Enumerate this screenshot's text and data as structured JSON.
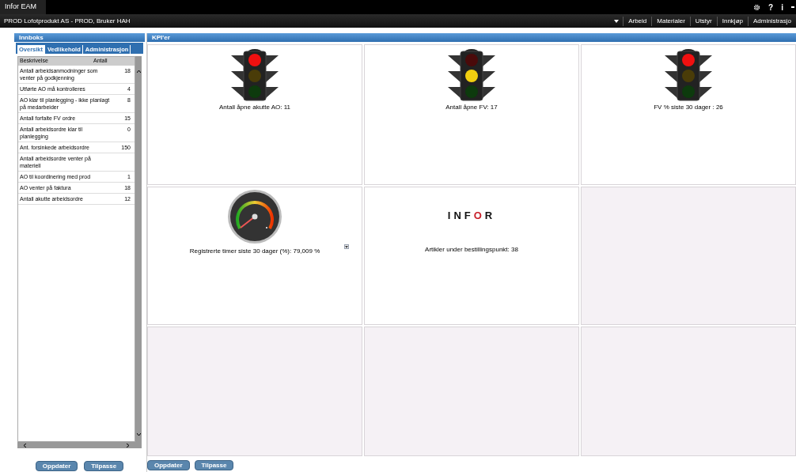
{
  "app": {
    "title": "Infor EAM",
    "context": "PROD Lofotprodukt AS - PROD, Bruker HAH",
    "top_icons": [
      "?",
      "i"
    ],
    "menu": [
      "Arbeid",
      "Materialer",
      "Utstyr",
      "Innkjøp",
      "Administrasjo"
    ]
  },
  "inbox": {
    "title": "Innboks",
    "tabs": [
      {
        "label": "Oversikt",
        "selected": true
      },
      {
        "label": "Vedlikehold",
        "selected": false
      },
      {
        "label": "Administrasjon",
        "selected": false
      }
    ],
    "columns": [
      "Beskrivelse",
      "Antall"
    ],
    "rows": [
      {
        "description": "Antall arbeidsanmodninger som venter på godkjenning",
        "count": "18"
      },
      {
        "description": "Utførte AO må kontrolleres",
        "count": "4"
      },
      {
        "description": "AO klar til planlegging - ikke planlagt på medarbeider",
        "count": "8"
      },
      {
        "description": "Antall  forfalte FV ordre",
        "count": "15"
      },
      {
        "description": "Antall arbeidsordre klar til planlegging",
        "count": "0"
      },
      {
        "description": "Ant. forsinkede arbeidsordre",
        "count": "150"
      },
      {
        "description": "Antall arbeidsordre venter på materiell"
      },
      {
        "description": "AO til koordinering med prod",
        "count": "1"
      },
      {
        "description": "AO venter på faktura",
        "count": "18"
      },
      {
        "description": "Antall akutte arbeidsordre",
        "count": "12"
      }
    ],
    "buttons": [
      "Oppdater",
      "Tilpasse"
    ]
  },
  "kpi": {
    "title": "KPI'er",
    "tiles": [
      {
        "kind": "traffic",
        "color": "#f01010",
        "caption": "Antall åpne akutte AO: 11"
      },
      {
        "kind": "traffic",
        "color": "#f2cf10",
        "caption": "Antall åpne FV: 17"
      },
      {
        "kind": "traffic",
        "color": "#f01010",
        "caption": "FV % siste 30 dager : 26"
      },
      {
        "kind": "gauge",
        "caption": "Registrerte timer siste 30 dager (%): 79,009 %"
      },
      {
        "kind": "logo",
        "logo": "INFOR",
        "caption": "Artikler under bestillingspunkt: 38"
      },
      {
        "kind": "empty"
      },
      {
        "kind": "empty"
      },
      {
        "kind": "empty"
      },
      {
        "kind": "empty"
      }
    ],
    "buttons": [
      "Oppdater",
      "Tilpasse"
    ]
  }
}
